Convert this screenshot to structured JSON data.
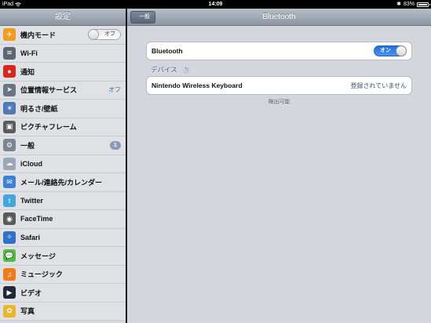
{
  "status": {
    "device": "iPad",
    "time": "14:09",
    "battery_text": "83%",
    "battery_level": 0.83
  },
  "master": {
    "title": "設定",
    "items": [
      {
        "label": "機内モード",
        "icon": "airplane-icon",
        "color": "#f39a1e",
        "accessory": "switch",
        "switch_text": "オフ"
      },
      {
        "label": "Wi-Fi",
        "icon": "wifi-icon",
        "color": "#5d6772"
      },
      {
        "label": "通知",
        "icon": "notifications-icon",
        "color": "#d9251d"
      },
      {
        "label": "位置情報サービス",
        "icon": "location-icon",
        "color": "#6a7482",
        "value": "オフ"
      },
      {
        "label": "明るさ/壁紙",
        "icon": "brightness-icon",
        "color": "#4f7ab8"
      },
      {
        "label": "ピクチャフレーム",
        "icon": "picture-frame-icon",
        "color": "#5b5b5b"
      },
      {
        "label": "一般",
        "icon": "gear-icon",
        "color": "#7d8590",
        "badge": "1"
      },
      {
        "label": "iCloud",
        "icon": "cloud-icon",
        "color": "#9aa7b8"
      },
      {
        "label": "メール/連絡先/カレンダー",
        "icon": "mail-icon",
        "color": "#3b82d6"
      },
      {
        "label": "Twitter",
        "icon": "twitter-icon",
        "color": "#43a6e0"
      },
      {
        "label": "FaceTime",
        "icon": "facetime-icon",
        "color": "#5a5a5a"
      },
      {
        "label": "Safari",
        "icon": "safari-icon",
        "color": "#2e73c9"
      },
      {
        "label": "メッセージ",
        "icon": "messages-icon",
        "color": "#4cbf3c"
      },
      {
        "label": "ミュージック",
        "icon": "music-icon",
        "color": "#f07a1a"
      },
      {
        "label": "ビデオ",
        "icon": "video-icon",
        "color": "#1f2a38"
      },
      {
        "label": "写真",
        "icon": "photos-icon",
        "color": "#e8b82a"
      }
    ]
  },
  "detail": {
    "back_label": "一般",
    "title": "Bluetooth",
    "bluetooth_label": "Bluetooth",
    "bluetooth_switch": "オン",
    "devices_header": "デバイス",
    "devices": [
      {
        "name": "Nintendo Wireless Keyboard",
        "status": "登録されていません"
      }
    ],
    "discoverable_text": "検出可能"
  }
}
